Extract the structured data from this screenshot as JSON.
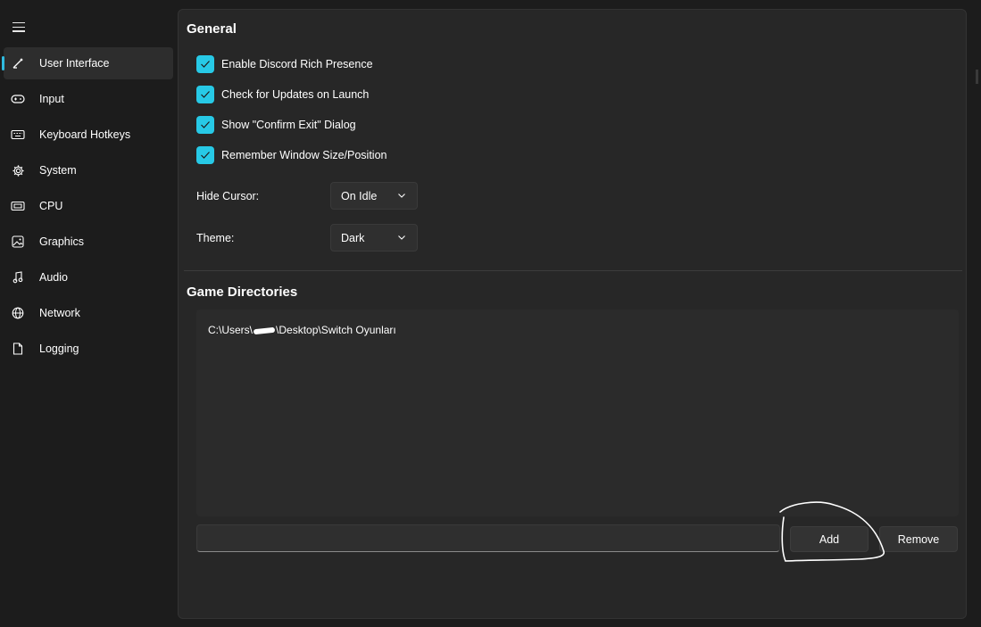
{
  "sidebar": {
    "items": [
      {
        "label": "User Interface",
        "icon": "pen-icon",
        "active": true
      },
      {
        "label": "Input",
        "icon": "gamepad-icon"
      },
      {
        "label": "Keyboard Hotkeys",
        "icon": "keyboard-icon"
      },
      {
        "label": "System",
        "icon": "gear-icon"
      },
      {
        "label": "CPU",
        "icon": "cpu-icon"
      },
      {
        "label": "Graphics",
        "icon": "image-icon"
      },
      {
        "label": "Audio",
        "icon": "music-note-icon"
      },
      {
        "label": "Network",
        "icon": "globe-icon"
      },
      {
        "label": "Logging",
        "icon": "document-icon"
      }
    ]
  },
  "general": {
    "title": "General",
    "checkboxes": [
      {
        "label": "Enable Discord Rich Presence",
        "checked": true
      },
      {
        "label": "Check for Updates on Launch",
        "checked": true
      },
      {
        "label": "Show \"Confirm Exit\" Dialog",
        "checked": true
      },
      {
        "label": "Remember Window Size/Position",
        "checked": true
      }
    ],
    "hide_cursor": {
      "label": "Hide Cursor:",
      "value": "On Idle"
    },
    "theme": {
      "label": "Theme:",
      "value": "Dark"
    }
  },
  "game_directories": {
    "title": "Game Directories",
    "items": [
      {
        "prefix": "C:\\Users\\",
        "suffix": "\\Desktop\\Switch Oyunları"
      }
    ],
    "path_input_value": "",
    "add_label": "Add",
    "remove_label": "Remove"
  },
  "colors": {
    "accent": "#27c9e6",
    "background": "#1c1c1c",
    "panel": "#272727",
    "annotation": "#ffffff"
  }
}
